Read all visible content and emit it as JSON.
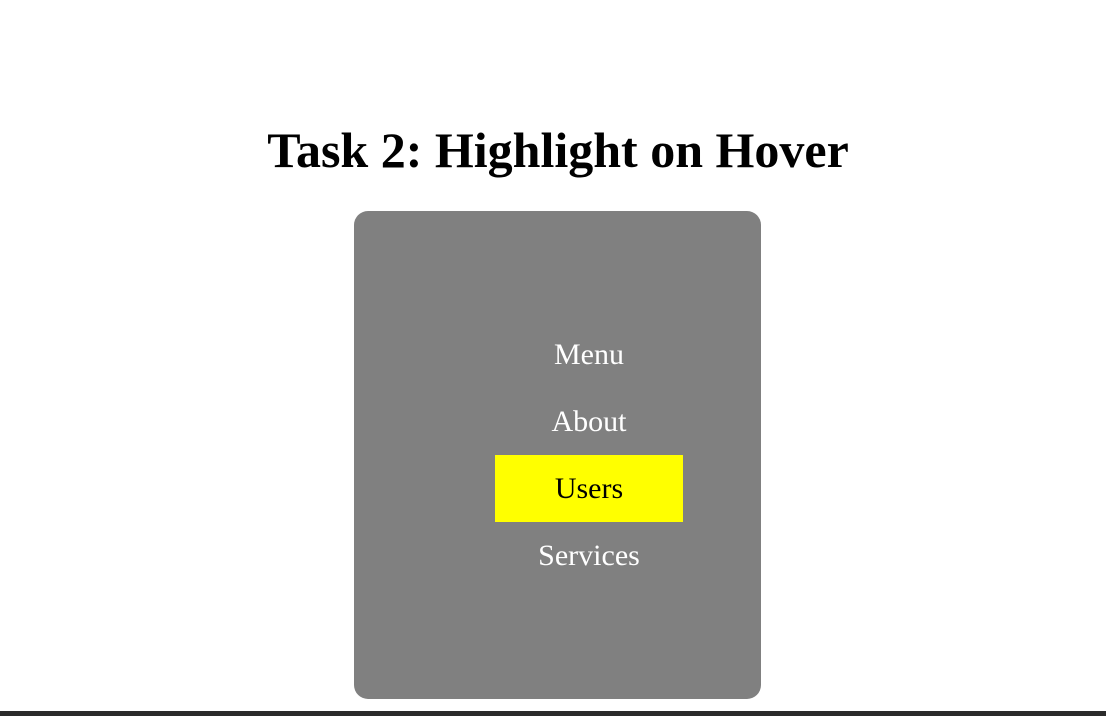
{
  "page": {
    "title": "Task 2: Highlight on Hover"
  },
  "menu": {
    "items": [
      {
        "label": "Menu",
        "state": "normal"
      },
      {
        "label": "About",
        "state": "normal"
      },
      {
        "label": "Users",
        "state": "hovered"
      },
      {
        "label": "Services",
        "state": "normal"
      }
    ]
  },
  "colors": {
    "panel_background": "#808080",
    "item_text": "#ffffff",
    "highlight_background": "#ffff00",
    "highlight_text": "#000000"
  }
}
